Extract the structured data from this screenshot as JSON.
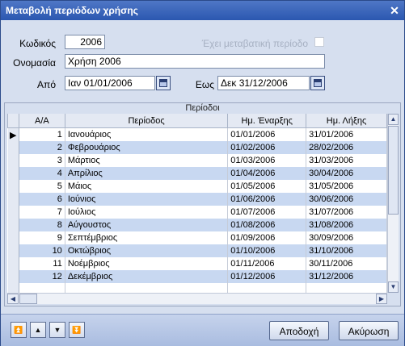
{
  "window": {
    "title": "Μεταβολή περιόδων χρήσης",
    "close_glyph": "✕"
  },
  "form": {
    "code_label": "Κωδικός",
    "code_value": "2006",
    "transitional_label": "Έχει μεταβατική περίοδο",
    "name_label": "Ονομασία",
    "name_value": "Χρήση 2006",
    "from_label": "Από",
    "from_value": "Ιαν 01/01/2006",
    "to_label": "Εως",
    "to_value": "Δεκ 31/12/2006"
  },
  "grid": {
    "caption": "Περίοδοι",
    "columns": [
      "Α/Α",
      "Περίοδος",
      "Ημ. Έναρξης",
      "Ημ. Λήξης"
    ],
    "rows": [
      [
        "1",
        "Ιανουάριος",
        "01/01/2006",
        "31/01/2006"
      ],
      [
        "2",
        "Φεβρουάριος",
        "01/02/2006",
        "28/02/2006"
      ],
      [
        "3",
        "Μάρτιος",
        "01/03/2006",
        "31/03/2006"
      ],
      [
        "4",
        "Απρίλιος",
        "01/04/2006",
        "30/04/2006"
      ],
      [
        "5",
        "Μάιος",
        "01/05/2006",
        "31/05/2006"
      ],
      [
        "6",
        "Ιούνιος",
        "01/06/2006",
        "30/06/2006"
      ],
      [
        "7",
        "Ιούλιος",
        "01/07/2006",
        "31/07/2006"
      ],
      [
        "8",
        "Αύγουστος",
        "01/08/2006",
        "31/08/2006"
      ],
      [
        "9",
        "Σεπτέμβριος",
        "01/09/2006",
        "30/09/2006"
      ],
      [
        "10",
        "Οκτώβριος",
        "01/10/2006",
        "31/10/2006"
      ],
      [
        "11",
        "Νοέμβριος",
        "01/11/2006",
        "30/11/2006"
      ],
      [
        "12",
        "Δεκέμβριος",
        "01/12/2006",
        "31/12/2006"
      ]
    ],
    "current_row_indicator": "▶"
  },
  "buttons": {
    "accept": "Αποδοχή",
    "cancel": "Ακύρωση",
    "nav_first": "⏫",
    "nav_up": "▲",
    "nav_down": "▼",
    "nav_last": "⏬"
  },
  "colors": {
    "titlebar": "#2b57b0",
    "row_alt": "#c8d8f1",
    "window_bg": "#d6dfef"
  }
}
